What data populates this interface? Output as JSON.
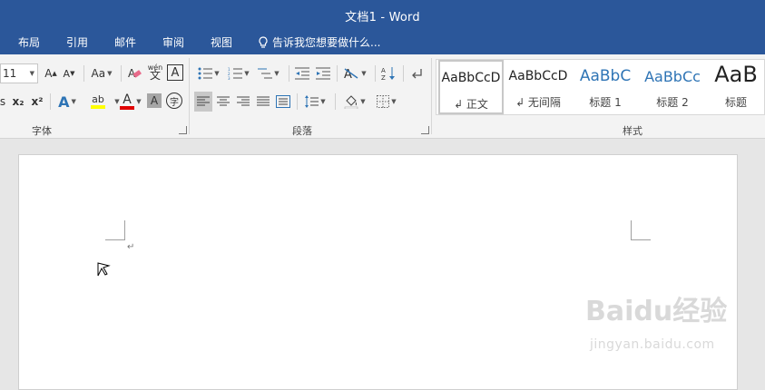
{
  "window": {
    "title": "文档1 - Word"
  },
  "tabs": [
    {
      "label": "布局"
    },
    {
      "label": "引用"
    },
    {
      "label": "邮件"
    },
    {
      "label": "审阅"
    },
    {
      "label": "视图"
    }
  ],
  "tell_me": {
    "label": "告诉我您想要做什么..."
  },
  "font_group": {
    "label": "字体",
    "font_size": "11",
    "change_case": "Aa",
    "grow_font": "A",
    "shrink_font": "A",
    "phonetic": "wén",
    "phonetic_char": "文",
    "char_border": "A",
    "subscript": "x₂",
    "superscript": "x²",
    "text_effects": "A",
    "highlight": "ab",
    "font_color": "A",
    "char_shading": "A",
    "enclose_char": "字"
  },
  "paragraph_group": {
    "label": "段落"
  },
  "styles_group": {
    "label": "样式",
    "styles": [
      {
        "sample": "AaBbCcD",
        "name": "↲ 正文",
        "selected": true
      },
      {
        "sample": "AaBbCcD",
        "name": "↲ 无间隔",
        "selected": false
      },
      {
        "sample": "AaBbC",
        "name": "标题 1",
        "selected": false
      },
      {
        "sample": "AaBbCc",
        "name": "标题 2",
        "selected": false
      },
      {
        "sample": "AaB",
        "name": "标题",
        "selected": false
      }
    ]
  },
  "document": {
    "paragraph_mark": "↵"
  },
  "watermark": {
    "text": "Baidu经验",
    "url": "jingyan.baidu.com"
  },
  "colors": {
    "title_bar": "#2b579a",
    "ribbon": "#f3f3f3",
    "heading_blue": "#2e74b5",
    "font_color_bar": "#e00000",
    "highlight_bar": "#ffff00"
  }
}
